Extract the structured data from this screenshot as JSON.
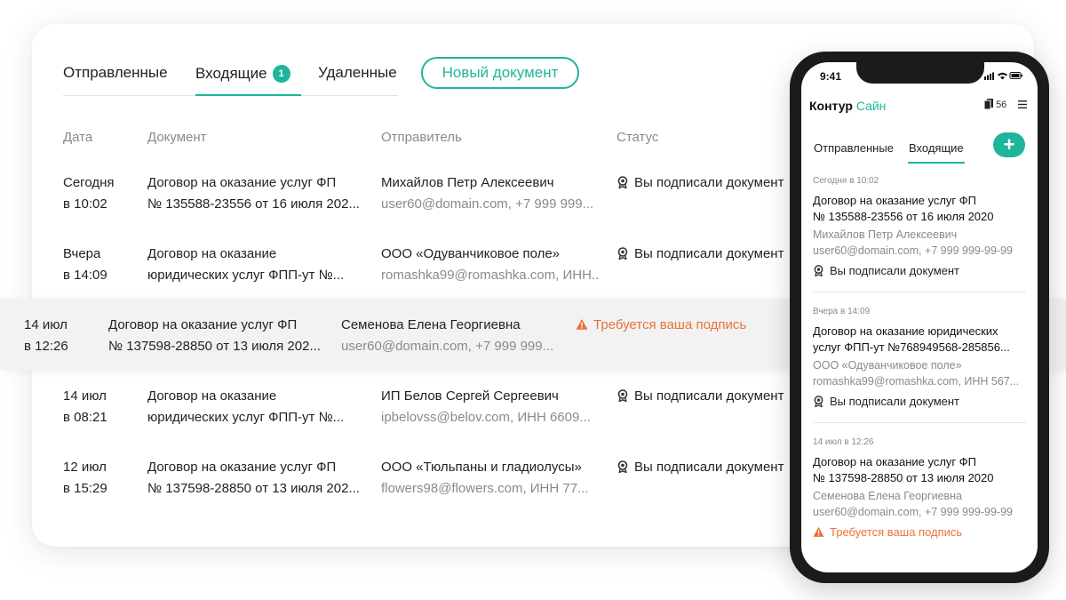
{
  "desktop": {
    "tabs": {
      "sent": "Отправленные",
      "inbox": "Входящие",
      "inbox_badge": "1",
      "deleted": "Удаленные"
    },
    "new_document_button": "Новый документ",
    "columns": {
      "date": "Дата",
      "document": "Документ",
      "sender": "Отправитель",
      "status": "Статус"
    },
    "rows": [
      {
        "date_line1": "Сегодня",
        "date_line2": "в 10:02",
        "doc_line1": "Договор на оказание услуг ФП",
        "doc_line2": "№ 135588-23556 от 16 июля 202...",
        "sender_name": "Михайлов Петр Алексеевич",
        "sender_contact": "user60@domain.com, +7 999 999...",
        "status": "Вы подписали документ"
      },
      {
        "date_line1": "Вчера",
        "date_line2": "в 14:09",
        "doc_line1": "Договор на оказание",
        "doc_line2": "юридических услуг ФПП-ут №...",
        "sender_name": "ООО «Одуванчиковое поле»",
        "sender_contact": "romashka99@romashka.com, ИНН...",
        "status": "Вы подписали документ"
      },
      {
        "date_line1": "14 июл",
        "date_line2": "в 12:26",
        "doc_line1": "Договор на оказание услуг ФП",
        "doc_line2": "№ 137598-28850 от 13 июля 202...",
        "sender_name": "Семенова Елена Георгиевна",
        "sender_contact": "user60@domain.com, +7 999 999...",
        "status": "Требуется ваша подпись"
      },
      {
        "date_line1": "14 июл",
        "date_line2": "в 08:21",
        "doc_line1": "Договор на оказание",
        "doc_line2": "юридических услуг ФПП-ут №...",
        "sender_name": "ИП Белов Сергей Сергеевич",
        "sender_contact": "ipbelovss@belov.com, ИНН 6609...",
        "status": "Вы подписали документ"
      },
      {
        "date_line1": "12 июл",
        "date_line2": "в 15:29",
        "doc_line1": "Договор на оказание услуг ФП",
        "doc_line2": "№ 137598-28850 от 13 июля 202...",
        "sender_name": "ООО «Тюльпаны и гладиолусы»",
        "sender_contact": "flowers98@flowers.com, ИНН 77...",
        "status": "Вы подписали документ"
      }
    ]
  },
  "mobile": {
    "time": "9:41",
    "logo_part1": "Контур",
    "logo_part2": "Сайн",
    "doc_count": "56",
    "tabs": {
      "sent": "Отправленные",
      "inbox": "Входящие"
    },
    "add_button": "+",
    "items": [
      {
        "meta": "Сегодня в 10:02",
        "doc_line1": "Договор на оказание услуг ФП",
        "doc_line2": "№ 135588-23556 от 16 июля 2020",
        "sender": "Михайлов Петр Алексеевич",
        "contact": "user60@domain.com, +7 999 999-99-99",
        "status": "Вы подписали документ"
      },
      {
        "meta": "Вчера в 14:09",
        "doc_line1": "Договор на оказание юридических",
        "doc_line2": "услуг ФПП-ут №768949568-285856...",
        "sender": "ООО «Одуванчиковое поле»",
        "contact": "romashka99@romashka.com, ИНН 567...",
        "status": "Вы подписали документ"
      },
      {
        "meta": "14 июл в 12:26",
        "doc_line1": "Договор на оказание услуг ФП",
        "doc_line2": "№ 137598-28850 от 13 июля 2020",
        "sender": "Семенова Елена Георгиевна",
        "contact": "user60@domain.com, +7 999 999-99-99",
        "status": "Требуется ваша подпись"
      }
    ]
  },
  "colors": {
    "accent": "#1fb59a",
    "warning": "#e8733a",
    "muted_text": "#8a8a8a"
  },
  "icons": {
    "signed": "signed-seal-icon",
    "warning": "warning-triangle-icon",
    "documents": "documents-icon",
    "menu": "menu-icon"
  }
}
